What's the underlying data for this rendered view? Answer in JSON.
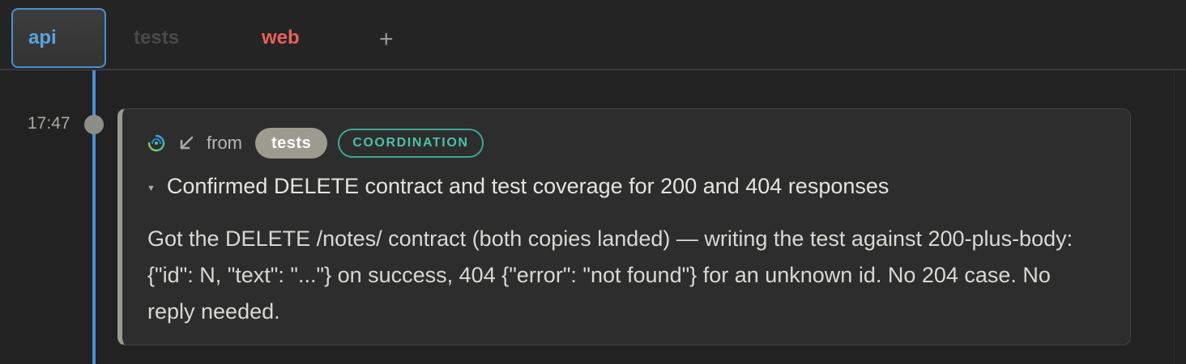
{
  "tabs": [
    {
      "label": "api",
      "state": "active",
      "color": "#5aa3e0"
    },
    {
      "label": "tests",
      "state": "dimmed",
      "color": "#4a4a4a"
    },
    {
      "label": "web",
      "state": "normal",
      "color": "#e8615a"
    }
  ],
  "add_tab_label": "+",
  "timeline": {
    "accent": "#4a90d0"
  },
  "message": {
    "time": "17:47",
    "source_icon": "swirl-logo-icon",
    "direction_icon": "arrow-down-left-icon",
    "from_label": "from",
    "sender": "tests",
    "kind": "COORDINATION",
    "kind_color": "#3aa894",
    "collapse_icon": "caret-down-icon",
    "summary": "Confirmed DELETE contract and test coverage for 200 and 404 responses",
    "body": "Got the DELETE /notes/ contract (both copies landed) — writing the test against 200-plus-body: {\"id\": N, \"text\": \"...\"} on success, 404 {\"error\": \"not found\"} for an unknown id. No 204 case. No reply needed."
  }
}
